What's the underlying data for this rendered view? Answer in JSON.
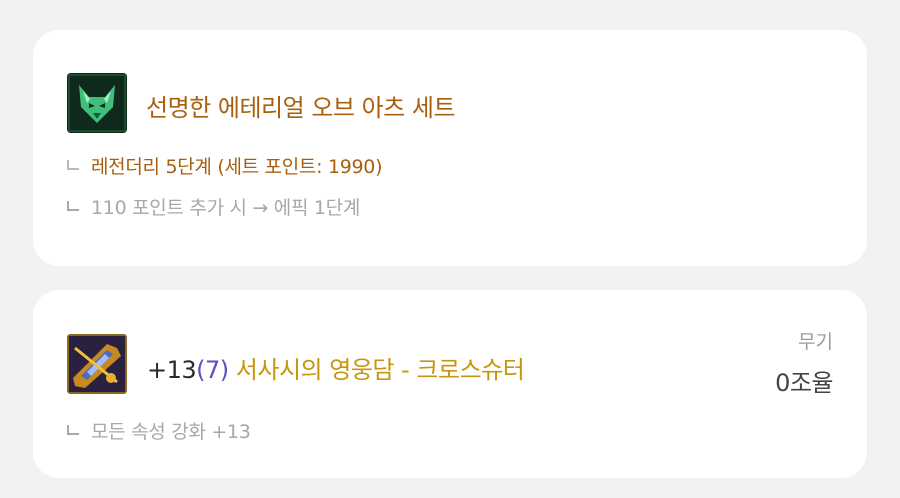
{
  "set_card": {
    "icon": "fox-mask-icon",
    "title": "선명한 에테리얼 오브 아츠 세트",
    "line1": "레전더리 5단계 (세트 포인트: 1990)",
    "line2": "110 포인트 추가 시 → 에픽 1단계",
    "colors": {
      "title": "#a8600f",
      "sub": "#a7a7ac"
    }
  },
  "weapon_card": {
    "icon": "crossbow-weapon-icon",
    "reinforce": "+13",
    "star_count": "(7)",
    "name": "서사시의 영웅담 - 크로스슈터",
    "option": "모든 속성 강화 +13",
    "slot_label": "무기",
    "slot_value": "0조율",
    "colors": {
      "star": "#5a4fc4",
      "name": "#c7960e"
    }
  }
}
